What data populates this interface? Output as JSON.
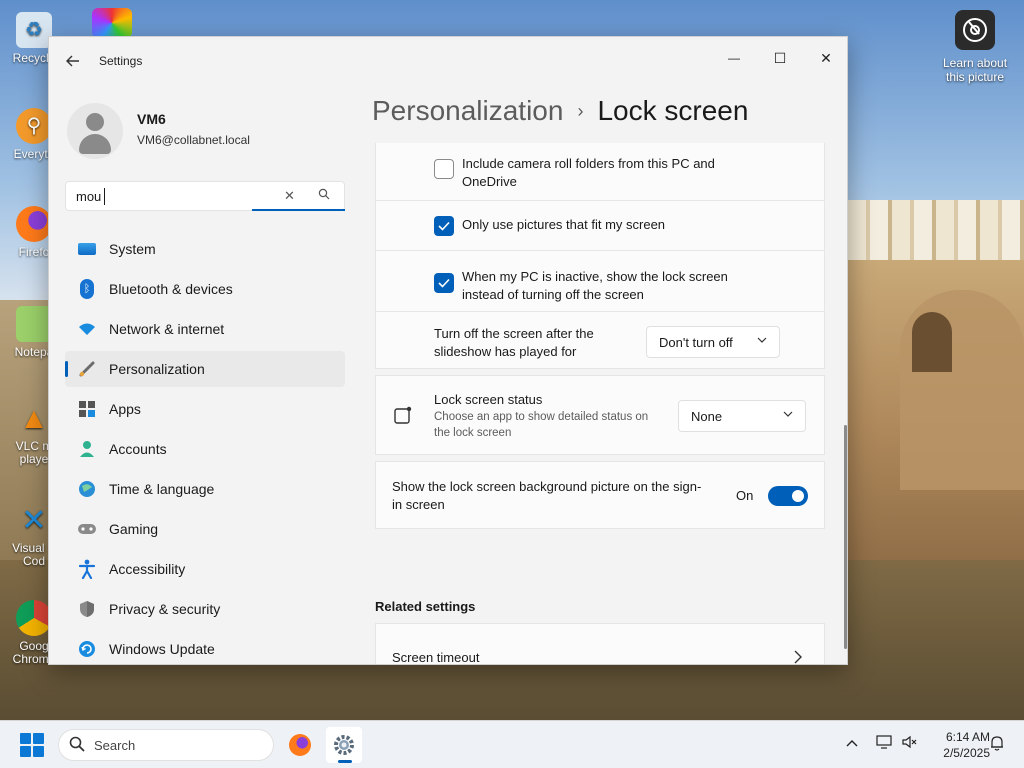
{
  "desktop": {
    "icons": [
      {
        "label": "Recycle",
        "icon": "recycle-bin-icon"
      },
      {
        "label": "Everyth",
        "icon": "everything-search-icon"
      },
      {
        "label": "Firefo",
        "icon": "firefox-icon"
      },
      {
        "label": "Notepa",
        "icon": "notepad-icon"
      },
      {
        "label": "VLC m playe",
        "icon": "vlc-icon"
      },
      {
        "label": "Visual S Cod",
        "icon": "vscode-icon"
      },
      {
        "label": "Goog Chrome",
        "icon": "chrome-icon"
      }
    ],
    "learn_label": "Learn about this picture"
  },
  "window": {
    "app_title": "Settings",
    "controls": {
      "minimize": "—",
      "maximize": "☐",
      "close": "✕"
    }
  },
  "profile": {
    "name": "VM6",
    "email": "VM6@collabnet.local"
  },
  "search": {
    "value": "mou",
    "clear_glyph": "✕",
    "icon": "search-icon"
  },
  "nav": {
    "items": [
      {
        "label": "System",
        "icon": "system-icon",
        "selected": false
      },
      {
        "label": "Bluetooth & devices",
        "icon": "bluetooth-icon",
        "selected": false
      },
      {
        "label": "Network & internet",
        "icon": "network-icon",
        "selected": false
      },
      {
        "label": "Personalization",
        "icon": "personalization-brush-icon",
        "selected": true
      },
      {
        "label": "Apps",
        "icon": "apps-icon",
        "selected": false
      },
      {
        "label": "Accounts",
        "icon": "accounts-icon",
        "selected": false
      },
      {
        "label": "Time & language",
        "icon": "time-language-icon",
        "selected": false
      },
      {
        "label": "Gaming",
        "icon": "gaming-icon",
        "selected": false
      },
      {
        "label": "Accessibility",
        "icon": "accessibility-icon",
        "selected": false
      },
      {
        "label": "Privacy & security",
        "icon": "shield-icon",
        "selected": false
      },
      {
        "label": "Windows Update",
        "icon": "windows-update-icon",
        "selected": false
      }
    ]
  },
  "breadcrumb": {
    "parent": "Personalization",
    "separator": "›",
    "current": "Lock screen"
  },
  "content": {
    "camera_roll": {
      "label": "Include camera roll folders from this PC and OneDrive",
      "checked": false
    },
    "fit_screen": {
      "label": "Only use pictures that fit my screen",
      "checked": true
    },
    "inactive": {
      "label": "When my PC is inactive, show the lock screen instead of turning off the screen",
      "checked": true
    },
    "turn_off": {
      "label": "Turn off the screen after the slideshow has played for",
      "value": "Don't turn off"
    },
    "status": {
      "title": "Lock screen status",
      "desc": "Choose an app to show detailed status on the lock screen",
      "value": "None",
      "icon": "lock-status-icon"
    },
    "signin_bg": {
      "label": "Show the lock screen background picture on the sign-in screen",
      "state": "On",
      "on": true
    },
    "related_title": "Related settings",
    "related": [
      {
        "label": "Screen timeout"
      }
    ]
  },
  "taskbar": {
    "search_placeholder": "Search",
    "apps": [
      {
        "name": "firefox-icon",
        "active": false
      },
      {
        "name": "settings-gear-icon",
        "active": true
      }
    ],
    "time": "6:14 AM",
    "date": "2/5/2025"
  },
  "colors": {
    "accent": "#005fb8",
    "window_bg": "#f3f3f3",
    "card_bg": "#fbfbfb"
  }
}
